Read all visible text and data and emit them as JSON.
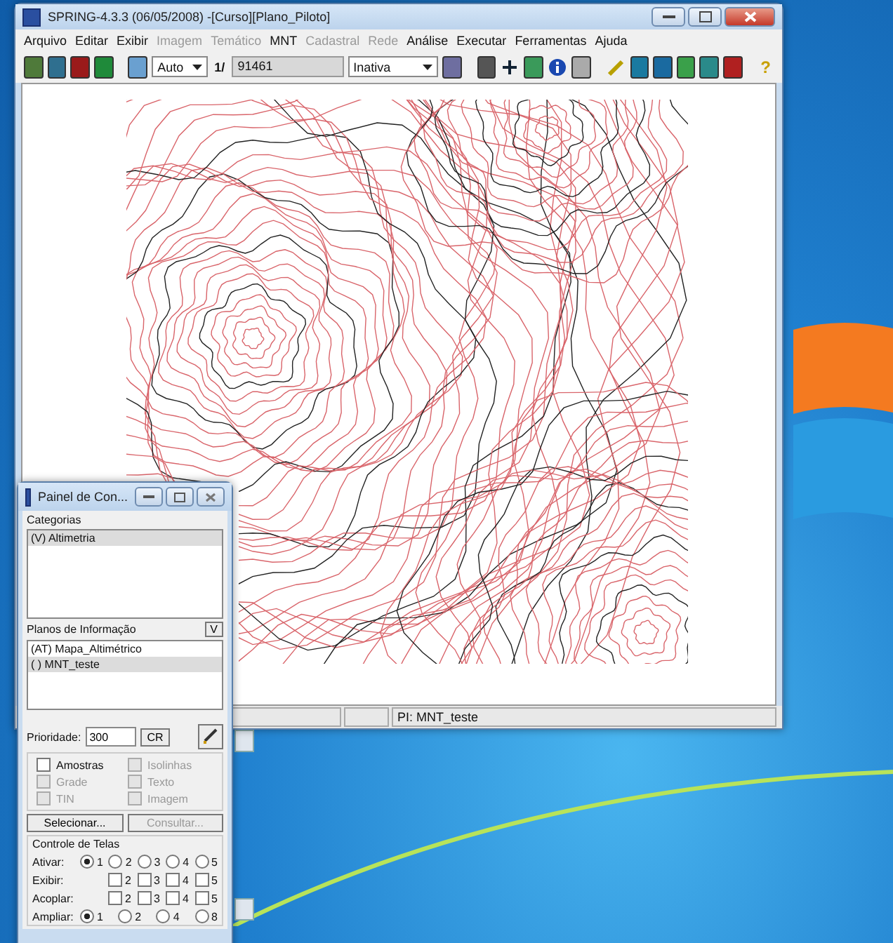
{
  "window": {
    "title": "SPRING-4.3.3 (06/05/2008) -[Curso][Plano_Piloto]"
  },
  "menu": [
    {
      "label": "Arquivo",
      "disabled": false
    },
    {
      "label": "Editar",
      "disabled": false
    },
    {
      "label": "Exibir",
      "disabled": false
    },
    {
      "label": "Imagem",
      "disabled": true
    },
    {
      "label": "Temático",
      "disabled": true
    },
    {
      "label": "MNT",
      "disabled": false
    },
    {
      "label": "Cadastral",
      "disabled": true
    },
    {
      "label": "Rede",
      "disabled": true
    },
    {
      "label": "Análise",
      "disabled": false
    },
    {
      "label": "Executar",
      "disabled": false
    },
    {
      "label": "Ferramentas",
      "disabled": false
    },
    {
      "label": "Ajuda",
      "disabled": false
    }
  ],
  "toolbar": {
    "zoom_mode": "Auto",
    "scale_prefix": "1/",
    "scale": "91461",
    "state": "Inativa",
    "help": "?"
  },
  "status_bar": {
    "plane": "PI: MNT_teste"
  },
  "panel": {
    "title": "Painel de Con...",
    "categories_label": "Categorias",
    "categories": [
      {
        "label": "(V) Altimetria",
        "selected": true
      }
    ],
    "planes_label": "Planos de Informação",
    "planes_button": "V",
    "planes": [
      {
        "label": "(AT) Mapa_Altimétrico",
        "selected": false
      },
      {
        "label": "( ) MNT_teste",
        "selected": true
      }
    ],
    "priority_label": "Prioridade:",
    "priority": "300",
    "cr_button": "CR",
    "options": [
      {
        "label": "Amostras",
        "checked": false,
        "disabled": false
      },
      {
        "label": "Isolinhas",
        "checked": false,
        "disabled": true
      },
      {
        "label": "Grade",
        "checked": false,
        "disabled": true
      },
      {
        "label": "Texto",
        "checked": false,
        "disabled": true
      },
      {
        "label": "TIN",
        "checked": false,
        "disabled": true
      },
      {
        "label": "Imagem",
        "checked": false,
        "disabled": true
      }
    ],
    "buttons": [
      {
        "label": "Selecionar...",
        "disabled": false
      },
      {
        "label": "Consultar...",
        "disabled": true
      }
    ],
    "screens": {
      "title": "Controle de Telas",
      "rows": [
        {
          "label": "Ativar:",
          "kind": "radio",
          "items": [
            {
              "label": "1",
              "selected": true
            },
            {
              "label": "2",
              "selected": false
            },
            {
              "label": "3",
              "selected": false
            },
            {
              "label": "4",
              "selected": false
            },
            {
              "label": "5",
              "selected": false
            }
          ]
        },
        {
          "label": "Exibir:",
          "kind": "checkbox",
          "items": [
            {
              "label": "2",
              "checked": false
            },
            {
              "label": "3",
              "checked": false
            },
            {
              "label": "4",
              "checked": false
            },
            {
              "label": "5",
              "checked": false
            }
          ]
        },
        {
          "label": "Acoplar:",
          "kind": "checkbox",
          "items": [
            {
              "label": "2",
              "checked": false
            },
            {
              "label": "3",
              "checked": false
            },
            {
              "label": "4",
              "checked": false
            },
            {
              "label": "5",
              "checked": false
            }
          ]
        },
        {
          "label": "Ampliar:",
          "kind": "radio",
          "items": [
            {
              "label": "1",
              "selected": true
            },
            {
              "label": "2",
              "selected": false
            },
            {
              "label": "4",
              "selected": false
            },
            {
              "label": "8",
              "selected": false
            }
          ]
        }
      ]
    }
  }
}
